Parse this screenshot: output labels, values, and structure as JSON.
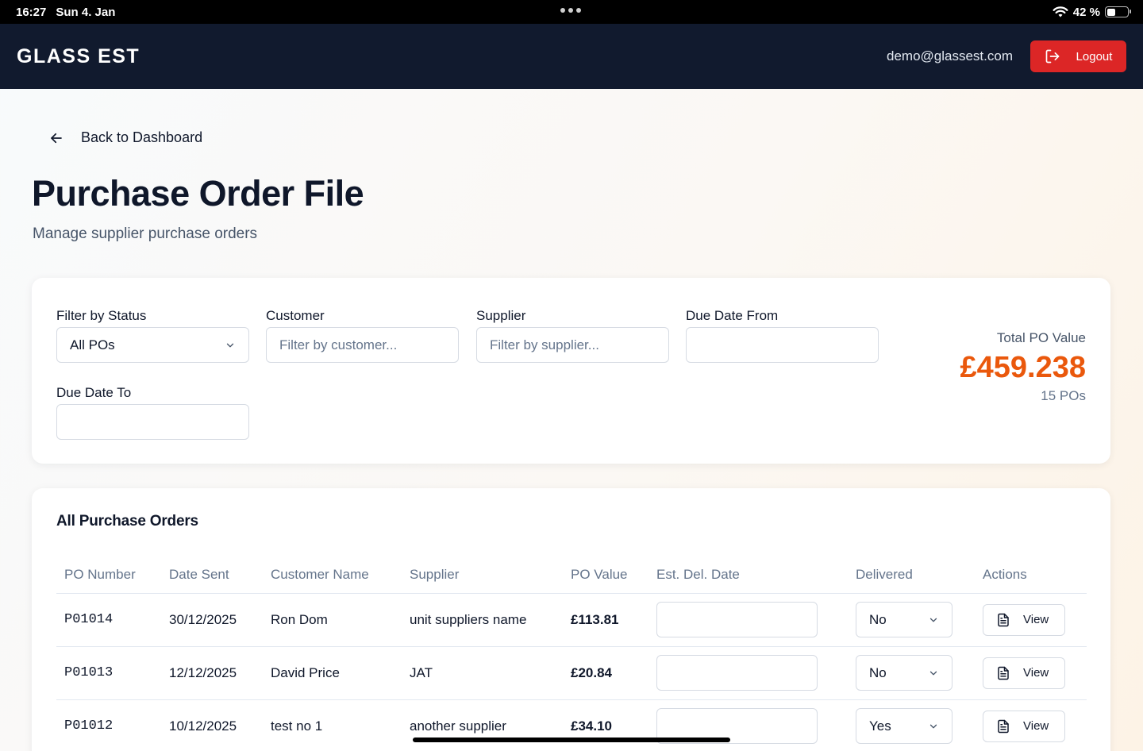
{
  "status_bar": {
    "time": "16:27",
    "date": "Sun 4. Jan",
    "battery": "42 %",
    "battery_level": 0.42
  },
  "header": {
    "logo": "GLASS EST",
    "user_email": "demo@glassest.com",
    "logout_label": "Logout"
  },
  "page": {
    "back_label": "Back to Dashboard",
    "title": "Purchase Order File",
    "subtitle": "Manage supplier purchase orders"
  },
  "filters": {
    "status_label": "Filter by Status",
    "status_value": "All POs",
    "customer_label": "Customer",
    "customer_placeholder": "Filter by customer...",
    "supplier_label": "Supplier",
    "supplier_placeholder": "Filter by supplier...",
    "due_from_label": "Due Date From",
    "due_to_label": "Due Date To"
  },
  "summary": {
    "label": "Total PO Value",
    "value": "£459.238",
    "count": "15 POs"
  },
  "table": {
    "title": "All Purchase Orders",
    "headers": [
      "PO Number",
      "Date Sent",
      "Customer Name",
      "Supplier",
      "PO Value",
      "Est. Del. Date",
      "Delivered",
      "Actions"
    ],
    "view_label": "View",
    "rows": [
      {
        "po": "P01014",
        "date": "30/12/2025",
        "customer": "Ron Dom",
        "supplier": "unit suppliers name",
        "value": "£113.81",
        "delivered": "No"
      },
      {
        "po": "P01013",
        "date": "12/12/2025",
        "customer": "David Price",
        "supplier": "JAT",
        "value": "£20.84",
        "delivered": "No"
      },
      {
        "po": "P01012",
        "date": "10/12/2025",
        "customer": "test no 1",
        "supplier": "another supplier",
        "value": "£34.10",
        "delivered": "Yes"
      }
    ]
  },
  "colors": {
    "header_bg": "#111a2e",
    "logout_bg": "#dc2626",
    "accent_total": "#ea580c"
  }
}
